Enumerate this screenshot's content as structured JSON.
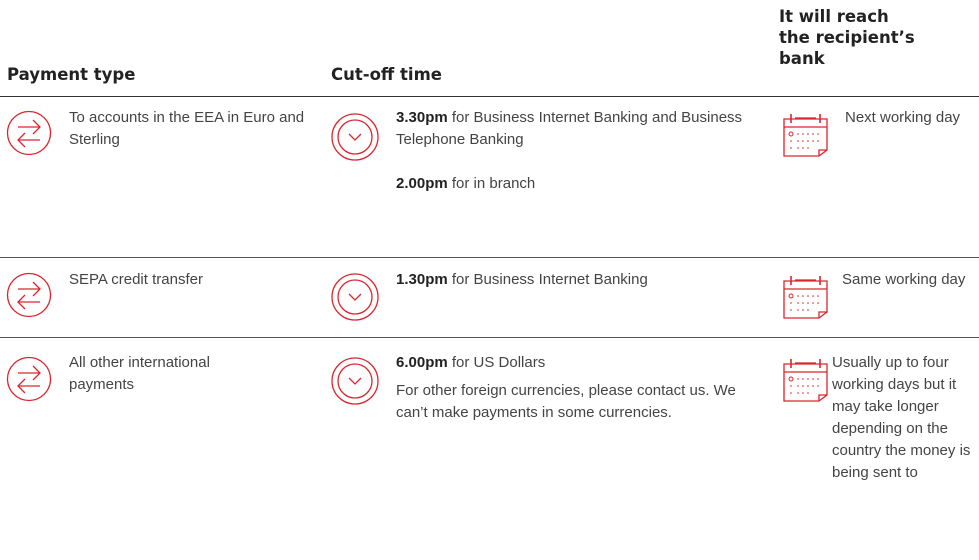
{
  "headers": {
    "payment_type": "Payment type",
    "cutoff_time": "Cut-off time",
    "reach_line1": "It will reach",
    "reach_line2": "the recipient’s",
    "reach_line3": "bank"
  },
  "rows": [
    {
      "payment_type": "To accounts in the EEA in Euro and Sterling",
      "cutoff": [
        {
          "time": "3.30pm",
          "text": " for Business Internet Banking and Business Telephone Banking"
        },
        {
          "time": "2.00pm",
          "text": " for in branch"
        }
      ],
      "reach": "Next working day"
    },
    {
      "payment_type": "SEPA credit transfer",
      "cutoff": [
        {
          "time": "1.30pm",
          "text": " for Business Internet Banking"
        }
      ],
      "reach": "Same working day"
    },
    {
      "payment_type": "All other international payments",
      "cutoff": [
        {
          "time": "6.00pm",
          "text": " for US Dollars"
        },
        {
          "time": "",
          "text": "For other foreign currencies, please contact us. We can’t make payments in some currencies."
        }
      ],
      "reach": "Usually up to four working days but it may take longer depending on the country the money is being sent to"
    }
  ],
  "colors": {
    "accent": "#d9262e",
    "text": "#444444",
    "heading": "#222222"
  },
  "icons": {
    "payment": "transfer-arrows-icon",
    "cutoff": "clock-icon",
    "reach": "calendar-icon"
  }
}
